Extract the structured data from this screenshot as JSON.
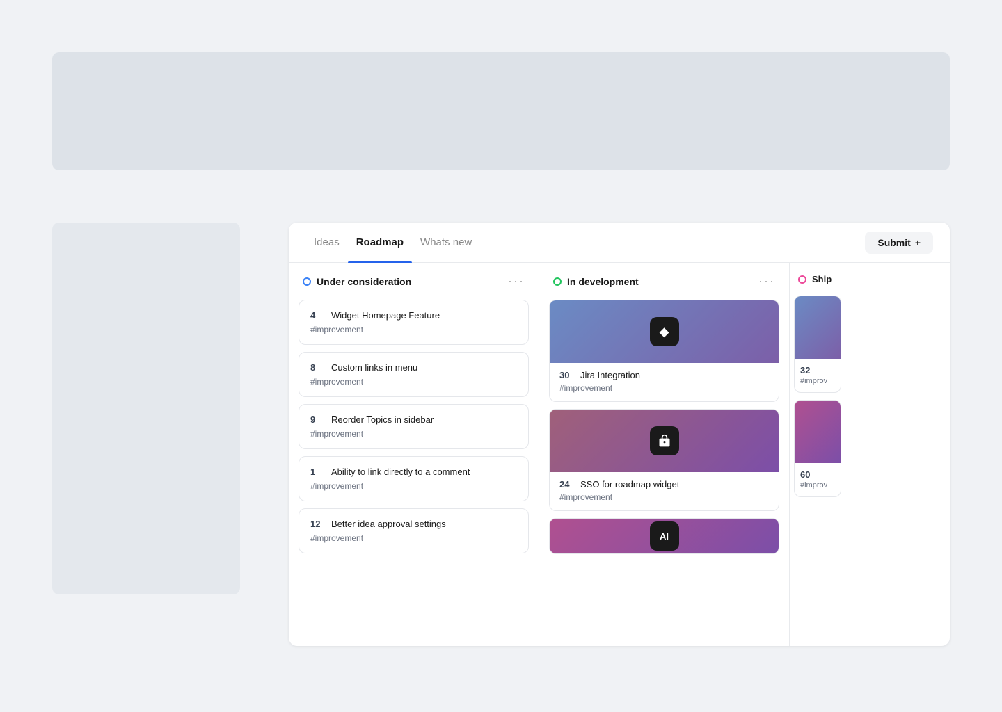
{
  "hero": {
    "alt": "Hero banner placeholder"
  },
  "sidebar": {
    "alt": "Sidebar placeholder"
  },
  "tabs": [
    {
      "id": "ideas",
      "label": "Ideas",
      "active": false
    },
    {
      "id": "roadmap",
      "label": "Roadmap",
      "active": true
    },
    {
      "id": "whats-new",
      "label": "Whats new",
      "active": false
    }
  ],
  "submit_button": "Submit",
  "columns": [
    {
      "id": "under-consideration",
      "title": "Under consideration",
      "dot_class": "dot-blue",
      "cards": [
        {
          "count": "4",
          "title": "Widget Homepage Feature",
          "tag": "#improvement"
        },
        {
          "count": "8",
          "title": "Custom links in menu",
          "tag": "#improvement"
        },
        {
          "count": "9",
          "title": "Reorder Topics in sidebar",
          "tag": "#improvement"
        },
        {
          "count": "1",
          "title": "Ability to link directly to a comment",
          "tag": "#improvement"
        },
        {
          "count": "12",
          "title": "Better idea approval settings",
          "tag": "#improvement"
        }
      ]
    },
    {
      "id": "in-development",
      "title": "In development",
      "dot_class": "dot-green",
      "image_cards": [
        {
          "count": "30",
          "title": "Jira Integration",
          "tag": "#improvement",
          "grad": "grad-blue-purple",
          "icon": "◆"
        },
        {
          "count": "24",
          "title": "SSO for roadmap widget",
          "tag": "#improvement",
          "grad": "grad-mauve-purple",
          "icon": "🔒"
        },
        {
          "count": "",
          "title": "",
          "tag": "",
          "grad": "grad-pink-purple",
          "icon": "Aİ"
        }
      ]
    },
    {
      "id": "shipped",
      "title": "Ship",
      "dot_class": "dot-pink",
      "partial": true,
      "image_cards": [
        {
          "count": "32",
          "tag": "#improv",
          "grad": "grad-blue-purple"
        },
        {
          "count": "60",
          "tag": "#improv",
          "grad": "grad-pink-purple"
        }
      ]
    }
  ],
  "colors": {
    "active_tab_underline": "#2563eb",
    "background": "#f0f2f5"
  }
}
